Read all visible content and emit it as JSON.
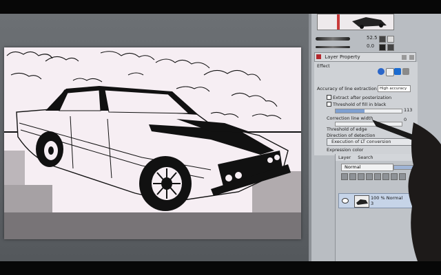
{
  "navigator": {
    "brush_size": "52.5",
    "brush_opacity": "0.0"
  },
  "layer_property": {
    "panel_title": "Layer Property",
    "effect_label": "Effect",
    "accuracy_label": "Accuracy of line extraction",
    "accuracy_value": "High accuracy",
    "extract_after_posterization": "Extract after posterization",
    "threshold_fill_black": "Threshold of fill in black",
    "threshold_fill_black_value": "113",
    "correction_line_width": "Correction line width",
    "correction_line_width_value": "0",
    "threshold_of_edge": "Threshold of edge",
    "direction_of_detection": "Direction of detection",
    "execution_button": "Execution of LT conversion",
    "expression_color": "Expression color"
  },
  "layer_panel": {
    "tab_layer": "Layer",
    "tab_second": "Search",
    "blend_mode": "Normal",
    "layer_opacity_percent": 100,
    "layer_opacity_text": "100 %",
    "layer_mode_text": "Normal",
    "layer_number": "3"
  },
  "colors": {
    "panel_bg": "#b9bdc2",
    "selected_layer": "#c6d4e8",
    "slider_fill": "#7e9fd0",
    "title_icon": "#b3282d"
  }
}
